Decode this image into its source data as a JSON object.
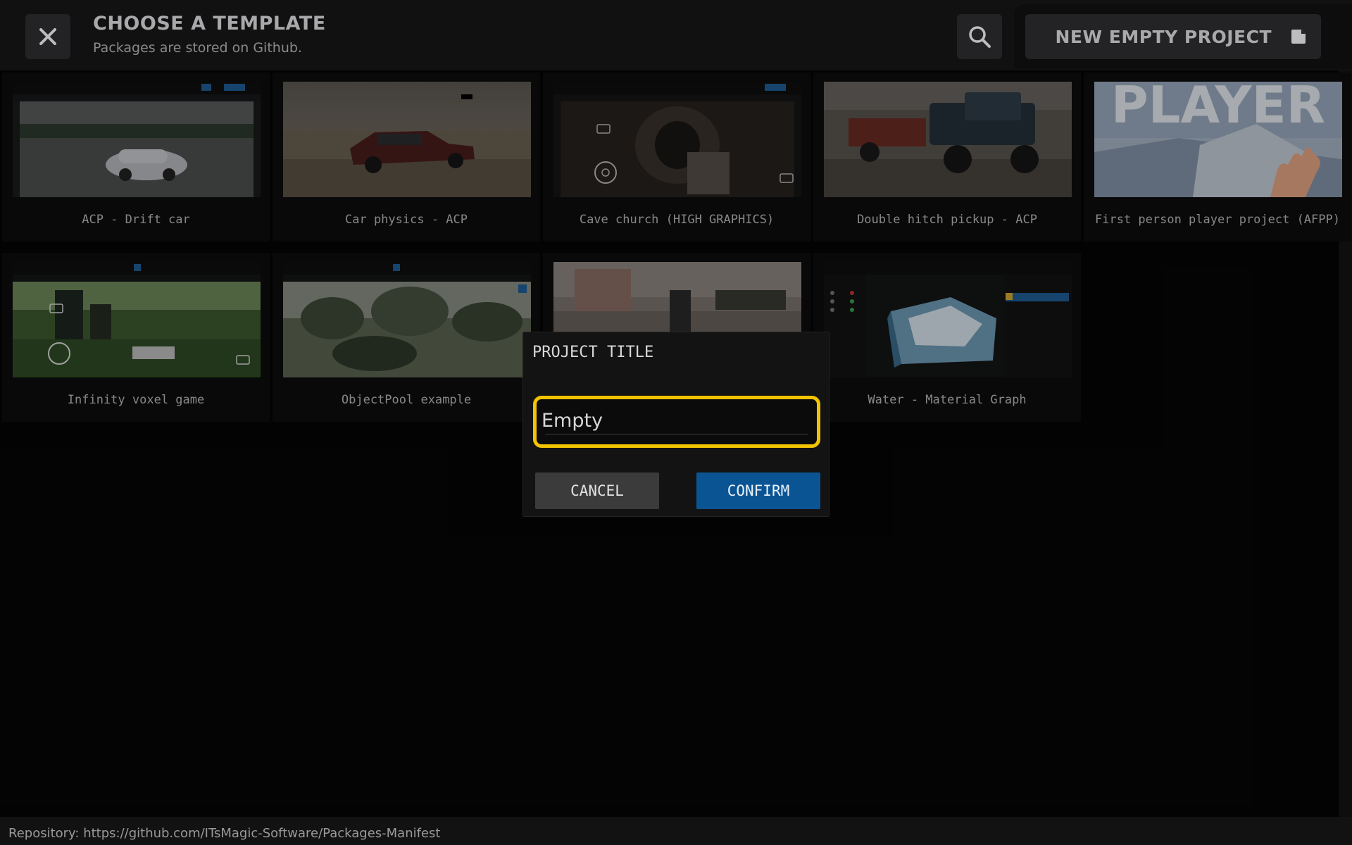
{
  "header": {
    "title": "CHOOSE A TEMPLATE",
    "subtitle": "Packages are stored on Github.",
    "new_project_label": "NEW EMPTY PROJECT",
    "close_icon": "close-icon",
    "search_icon": "search-icon",
    "new_project_icon": "new-file-icon"
  },
  "templates": [
    {
      "label": "ACP - Drift car"
    },
    {
      "label": "Car physics - ACP"
    },
    {
      "label": "Cave church (HIGH GRAPHICS)"
    },
    {
      "label": "Double hitch pickup - ACP"
    },
    {
      "label": "First person player project (AFPP)",
      "thumb_text": "PLAYER"
    },
    {
      "label": "Infinity voxel game"
    },
    {
      "label": "ObjectPool example"
    },
    {
      "label": ""
    },
    {
      "label": "Water - Material Graph"
    }
  ],
  "dialog": {
    "title": "PROJECT TITLE",
    "input_value": "Empty",
    "cancel_label": "CANCEL",
    "confirm_label": "CONFIRM",
    "input_border_color": "#f2c300",
    "confirm_color": "#0b5494"
  },
  "footer": {
    "repository_text": "Repository: https://github.com/ITsMagic-Software/Packages-Manifest"
  }
}
